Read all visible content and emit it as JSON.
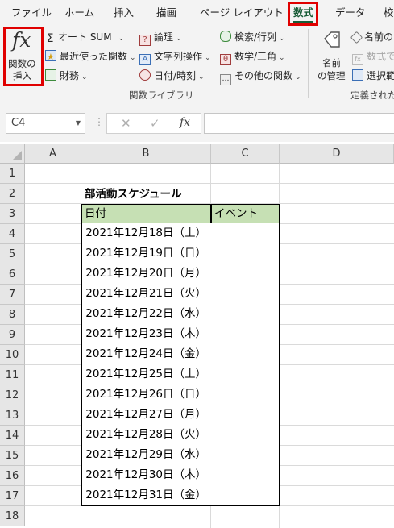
{
  "ribbon": {
    "tabs": [
      "ファイル",
      "ホーム",
      "挿入",
      "描画",
      "ページ レイアウト",
      "数式",
      "データ",
      "校"
    ],
    "insert_function": {
      "symbol": "fx",
      "line1": "関数の",
      "line2": "挿入"
    },
    "library": {
      "autosum": "オート SUM",
      "recent": "最近使った関数",
      "financial": "財務",
      "logical": "論理",
      "text": "文字列操作",
      "datetime": "日付/時刻",
      "lookup": "検索/行列",
      "math": "数学/三角",
      "more": "その他の関数",
      "group_label": "関数ライブラリ"
    },
    "names": {
      "manager_line1": "名前",
      "manager_line2": "の管理",
      "define": "名前の",
      "use_in_formula": "数式で",
      "create_from_selection": "選択範",
      "group_label": "定義された名"
    }
  },
  "formula_bar": {
    "name_box": "C4",
    "cancel": "✕",
    "enter": "✓",
    "fx": "fx",
    "value": ""
  },
  "sheet": {
    "columns": [
      "A",
      "B",
      "C",
      "D"
    ],
    "rows": [
      "1",
      "2",
      "3",
      "4",
      "5",
      "6",
      "7",
      "8",
      "9",
      "10",
      "11",
      "12",
      "13",
      "14",
      "15",
      "16",
      "17",
      "18"
    ],
    "title": "部活動スケジュール",
    "headers": [
      "日付",
      "イベント"
    ],
    "dates": [
      "2021年12月18日（土）",
      "2021年12月19日（日）",
      "2021年12月20日（月）",
      "2021年12月21日（火）",
      "2021年12月22日（水）",
      "2021年12月23日（木）",
      "2021年12月24日（金）",
      "2021年12月25日（土）",
      "2021年12月26日（日）",
      "2021年12月27日（月）",
      "2021年12月28日（火）",
      "2021年12月29日（水）",
      "2021年12月30日（木）",
      "2021年12月31日（金）"
    ]
  },
  "colors": {
    "header_fill": "#c6e0b4",
    "highlight": "#e00000",
    "accent": "#185c37"
  }
}
